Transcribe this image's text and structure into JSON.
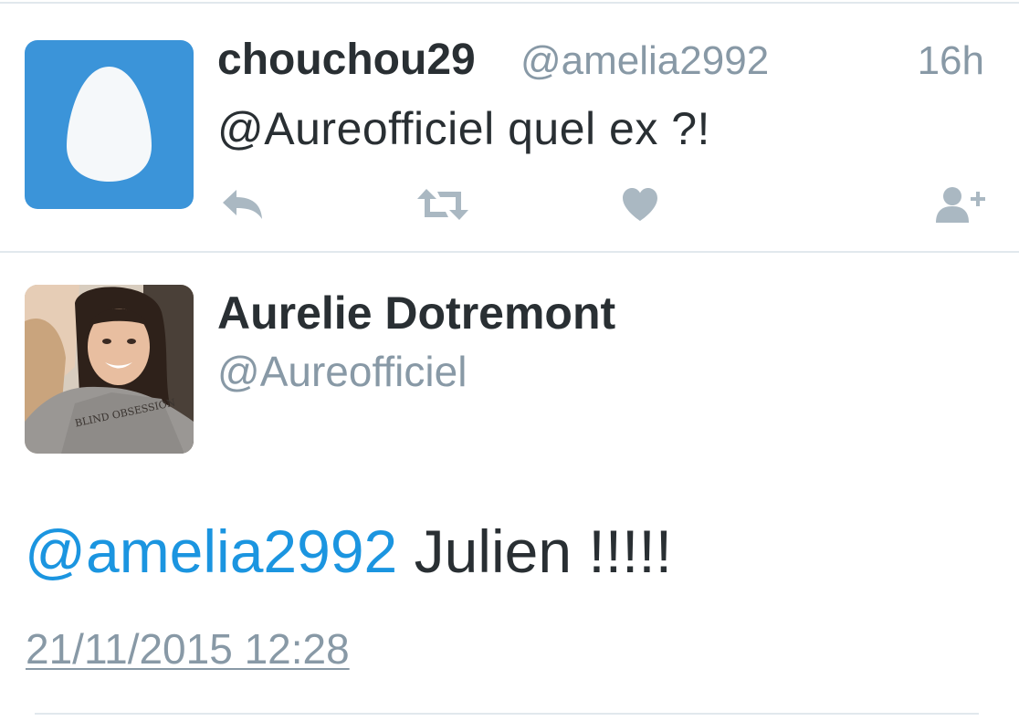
{
  "reply_tweet": {
    "display_name": "chouchou29",
    "handle": "@amelia2992",
    "time": "16h",
    "text": "@Aureofficiel quel ex ?!",
    "actions": [
      {
        "name": "reply",
        "icon": "reply-icon"
      },
      {
        "name": "retweet",
        "icon": "retweet-icon"
      },
      {
        "name": "like",
        "icon": "heart-icon"
      },
      {
        "name": "follow",
        "icon": "follow-user-icon"
      }
    ],
    "avatar_icon": "egg-icon",
    "avatar_color": "#3b94d9"
  },
  "main_tweet": {
    "display_name": "Aurelie Dotremont",
    "handle": "@Aureofficiel",
    "mention": "@amelia2992",
    "text": " Julien !!!!!",
    "timestamp": "21/11/2015 12:28",
    "avatar_shirt_text": "BLIND OBSESSION",
    "mention_color": "#1b95e0"
  },
  "colors": {
    "text": "#292f33",
    "muted": "#8899a6",
    "icon": "#aab8c2",
    "divider": "#e1e8ed"
  }
}
